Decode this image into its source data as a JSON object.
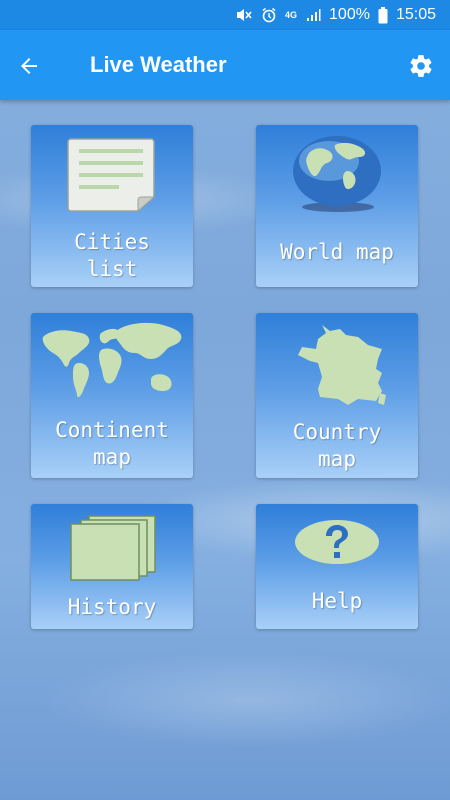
{
  "status_bar": {
    "network": "4G",
    "battery": "100%",
    "time": "15:05"
  },
  "app_bar": {
    "title": "Live Weather",
    "back_icon": "arrow-left-icon",
    "settings_icon": "gear-icon"
  },
  "tiles": [
    {
      "label": "Cities\nlist",
      "icon": "document-icon"
    },
    {
      "label": "World map",
      "icon": "globe-icon"
    },
    {
      "label": "Continent\nmap",
      "icon": "world-map-icon"
    },
    {
      "label": "Country\nmap",
      "icon": "france-map-icon"
    },
    {
      "label": "History",
      "icon": "stacked-cards-icon"
    },
    {
      "label": "Help",
      "icon": "question-bubble-icon"
    }
  ],
  "colors": {
    "app_bar": "#2196f3",
    "status_bar": "#1e88e5",
    "tile_top": "#2f7fd9",
    "tile_bottom": "#a9d0f7",
    "icon_green": "#c9e0b5"
  }
}
